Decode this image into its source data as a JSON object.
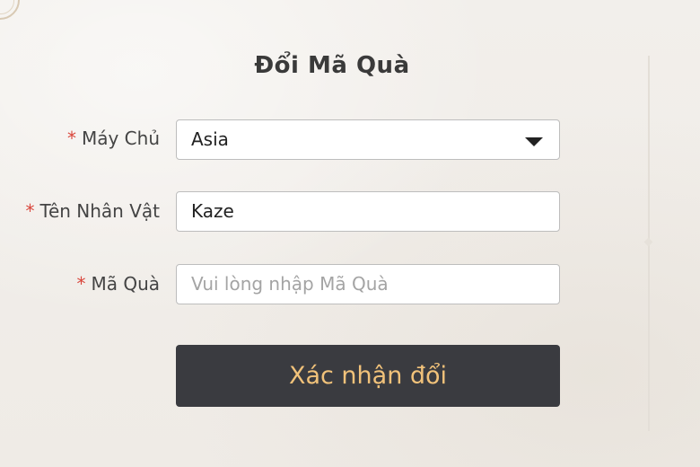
{
  "form": {
    "title": "Đổi Mã Quà",
    "required_marker": "*",
    "server": {
      "label": "Máy Chủ",
      "value": "Asia"
    },
    "character": {
      "label": "Tên Nhân Vật",
      "value": "Kaze"
    },
    "code": {
      "label": "Mã Quà",
      "placeholder": "Vui lòng nhập Mã Quà",
      "value": ""
    },
    "submit_label": "Xác nhận đổi"
  },
  "colors": {
    "required": "#d9453b",
    "button_bg": "#3a3b40",
    "button_text": "#f1c27a"
  },
  "icons": {
    "dropdown": "chevron-down-icon"
  }
}
